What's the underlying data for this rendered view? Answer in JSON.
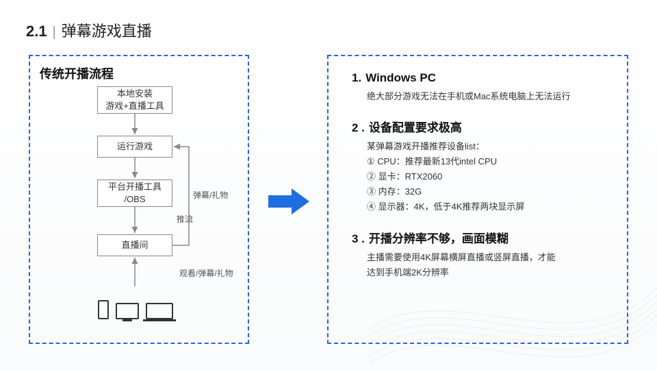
{
  "heading": {
    "num": "2.1",
    "bar": "|",
    "title": "弹幕游戏直播"
  },
  "left": {
    "title": "传统开播流程",
    "boxes": {
      "b1": "本地安装\n游戏+直播工具",
      "b2": "运行游戏",
      "b3": "平台开播工具\n/OBS",
      "b4": "直播间"
    },
    "labels": {
      "push": "推流",
      "danmu_gift": "弹幕/礼物",
      "watch": "观看/弹幕/礼物"
    }
  },
  "right": {
    "items": [
      {
        "idx": "1.",
        "title": "Windows PC",
        "lines": [
          "绝大部分游戏无法在手机或Mac系统电脑上无法运行"
        ]
      },
      {
        "idx": "2 .",
        "title": "设备配置要求极高",
        "lines": [
          "某弹幕游戏开播推荐设备list：",
          "① CPU：推荐最新13代intel CPU",
          "② 显卡：RTX2060",
          "③ 内存：32G",
          "④ 显示器：4K，低于4K推荐两块显示屏"
        ]
      },
      {
        "idx": "3 .",
        "title": "开播分辨率不够，画面模糊",
        "lines": [
          "主播需要使用4K屏幕横屏直播或竖屏直播，才能",
          "达到手机端2K分辨率"
        ]
      }
    ]
  },
  "chart_data": {
    "type": "diagram",
    "title": "传统开播流程",
    "nodes": [
      {
        "id": "install",
        "label": "本地安装 游戏+直播工具"
      },
      {
        "id": "run",
        "label": "运行游戏"
      },
      {
        "id": "obs",
        "label": "平台开播工具 /OBS"
      },
      {
        "id": "room",
        "label": "直播间"
      },
      {
        "id": "viewers",
        "label": "观众设备(手机/平板/电脑)"
      }
    ],
    "edges": [
      {
        "from": "install",
        "to": "run"
      },
      {
        "from": "run",
        "to": "obs"
      },
      {
        "from": "obs",
        "to": "room",
        "label": "推流"
      },
      {
        "from": "room",
        "to": "run",
        "label": "弹幕/礼物",
        "style": "feedback"
      },
      {
        "from": "viewers",
        "to": "room",
        "label": "观看/弹幕/礼物"
      }
    ]
  }
}
